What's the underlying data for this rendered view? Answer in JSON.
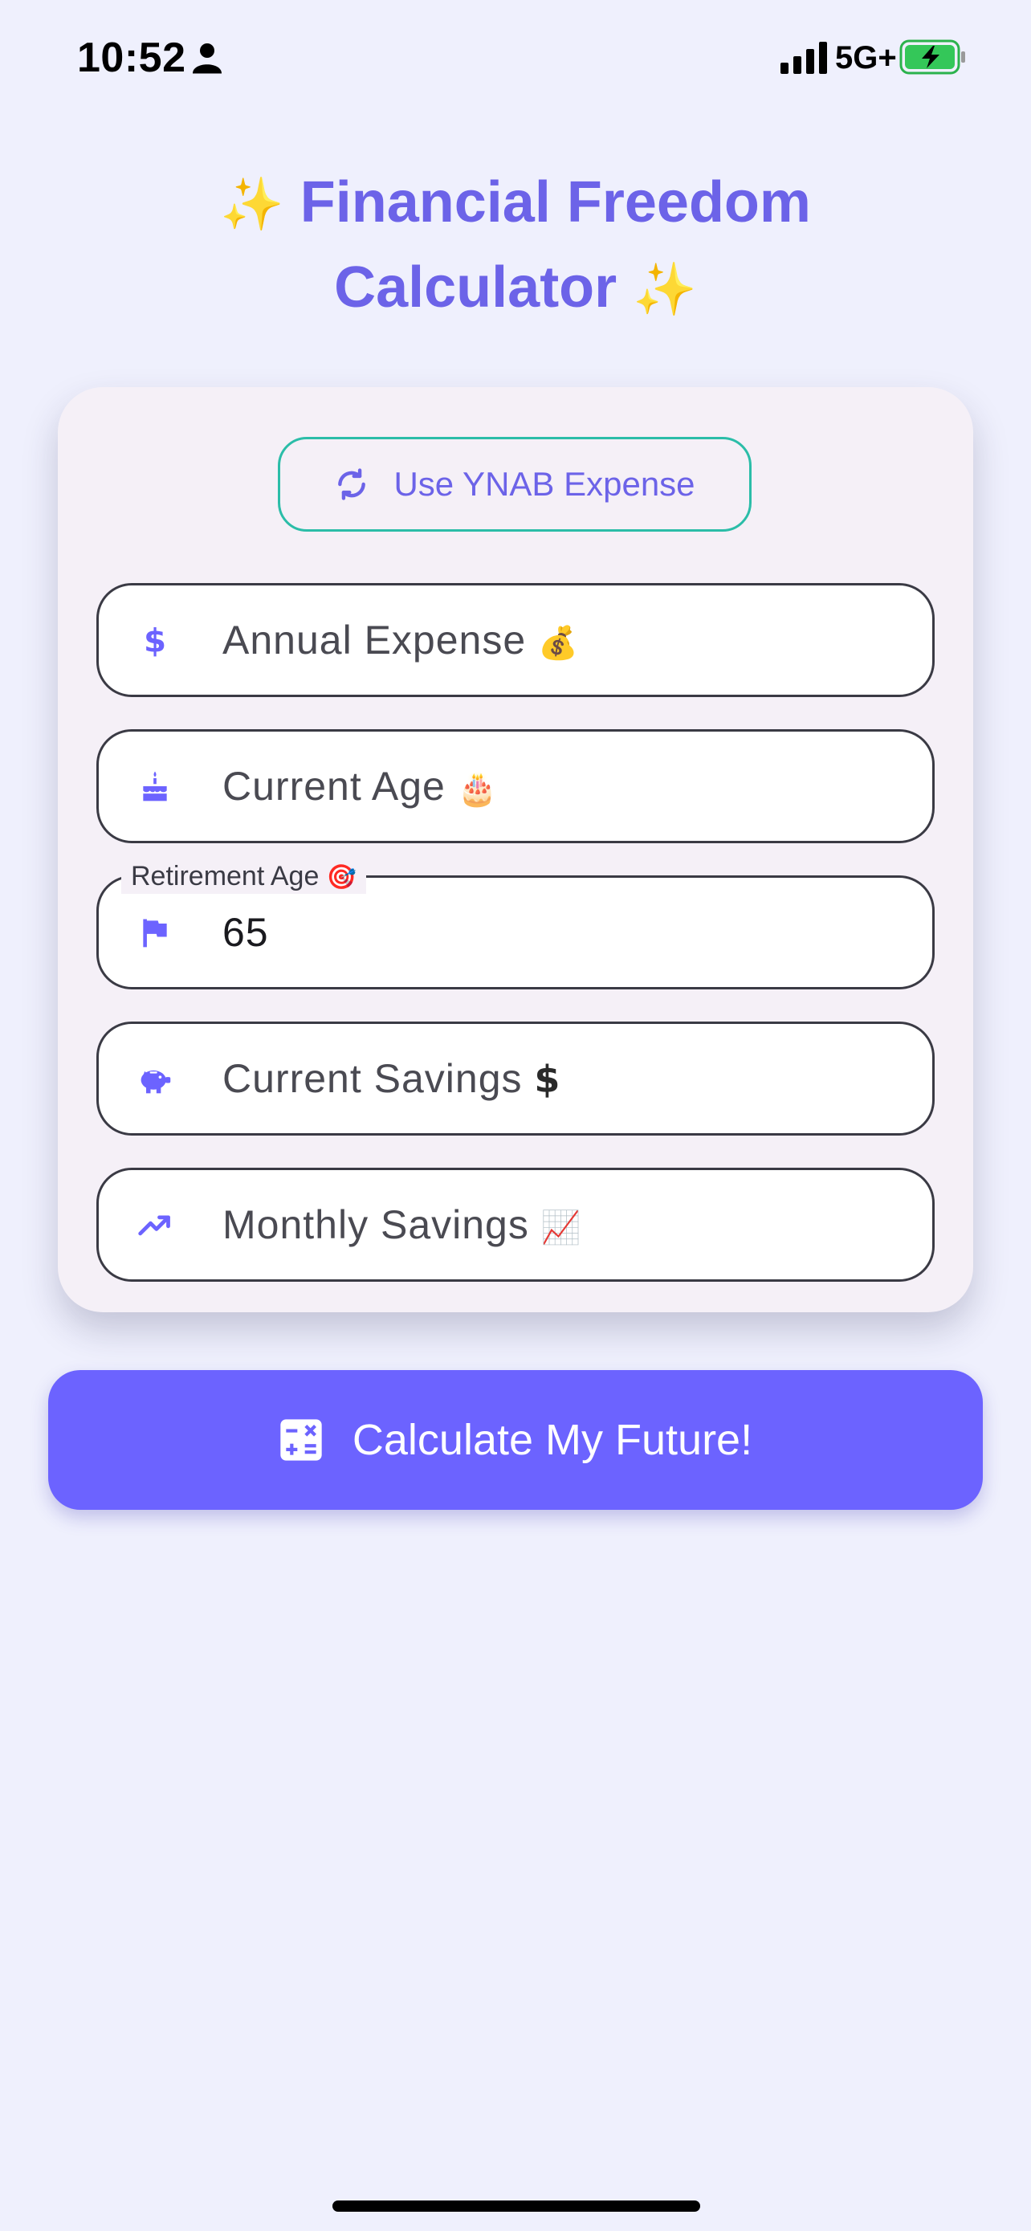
{
  "status_bar": {
    "time": "10:52",
    "network": "5G+",
    "icons": [
      "person-icon",
      "signal-icon",
      "battery-charging-icon"
    ]
  },
  "title": {
    "sparkle_left": "✨",
    "line1": "Financial Freedom",
    "line2": "Calculator",
    "sparkle_right": "✨"
  },
  "card": {
    "ynab_button": {
      "label": "Use YNAB Expense",
      "icon": "sync-icon"
    },
    "fields": {
      "annual_expense": {
        "placeholder": "Annual Expense",
        "emoji": "💰",
        "icon": "dollar-icon",
        "value": ""
      },
      "current_age": {
        "placeholder": "Current Age",
        "emoji": "🎂",
        "icon": "cake-icon",
        "value": ""
      },
      "retirement_age": {
        "label": "Retirement Age",
        "emoji": "🎯",
        "icon": "flag-icon",
        "value": "65"
      },
      "current_savings": {
        "placeholder": "Current Savings",
        "emoji": "$",
        "icon": "piggy-bank-icon",
        "value": ""
      },
      "monthly_savings": {
        "placeholder": "Monthly Savings",
        "emoji": "📈",
        "icon": "trending-up-icon",
        "value": ""
      }
    }
  },
  "calculate_button": {
    "label": "Calculate My Future!",
    "icon": "calculator-icon"
  },
  "colors": {
    "background": "#eff0fd",
    "accent": "#6c63ff",
    "title": "#6c63e8",
    "ynab_border": "#2bbda8",
    "card": "#f5f0f7"
  }
}
